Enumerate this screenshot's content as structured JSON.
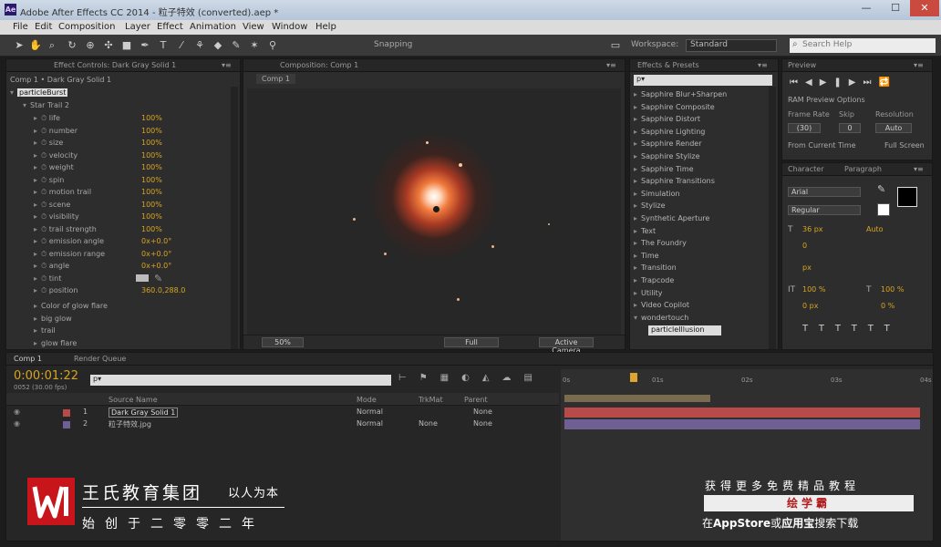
{
  "window": {
    "title": "Adobe After Effects CC 2014 - 粒子特效 (converted).aep *",
    "minimize": "—",
    "maximize": "☐",
    "close": "✕"
  },
  "menu": [
    "File",
    "Edit",
    "Composition",
    "Layer",
    "Effect",
    "Animation",
    "View",
    "Window",
    "Help"
  ],
  "toolbar": {
    "snapping": "Snapping",
    "workspace_label": "Workspace:",
    "workspace_value": "Standard",
    "search_placeholder": "Search Help"
  },
  "effect_controls": {
    "tab": "Effect Controls: Dark Gray Solid 1",
    "breadcrumb": "Comp 1 • Dark Gray Solid 1",
    "effect_name": "particleBurst",
    "group": "Star Trail 2",
    "props": [
      {
        "name": "life",
        "value": "100%"
      },
      {
        "name": "number",
        "value": "100%"
      },
      {
        "name": "size",
        "value": "100%"
      },
      {
        "name": "velocity",
        "value": "100%"
      },
      {
        "name": "weight",
        "value": "100%"
      },
      {
        "name": "spin",
        "value": "100%"
      },
      {
        "name": "motion trail",
        "value": "100%"
      },
      {
        "name": "scene",
        "value": "100%"
      },
      {
        "name": "visibility",
        "value": "100%"
      },
      {
        "name": "trail strength",
        "value": "100%"
      },
      {
        "name": "emission angle",
        "value": "0x+0.0°"
      },
      {
        "name": "emission range",
        "value": "0x+0.0°"
      },
      {
        "name": "angle",
        "value": "0x+0.0°"
      },
      {
        "name": "tint",
        "value": ""
      },
      {
        "name": "position",
        "value": "360.0,288.0"
      }
    ],
    "subgroups": [
      "Color of glow flare",
      "big glow",
      "trail",
      "glow flare"
    ]
  },
  "composition": {
    "tab": "Composition: Comp 1",
    "sub_tab": "Comp 1",
    "zoom": "50%",
    "quality": "Full",
    "view": "Active Camera"
  },
  "effects_presets": {
    "tab": "Effects & Presets",
    "search": "p▾",
    "items": [
      "Sapphire Blur+Sharpen",
      "Sapphire Composite",
      "Sapphire Distort",
      "Sapphire Lighting",
      "Sapphire Render",
      "Sapphire Stylize",
      "Sapphire Time",
      "Sapphire Transitions",
      "Simulation",
      "Stylize",
      "Synthetic Aperture",
      "Text",
      "The Foundry",
      "Time",
      "Transition",
      "Trapcode",
      "Utility",
      "Video Copilot",
      "wondertouch"
    ],
    "selected": "particleIllusion"
  },
  "preview": {
    "tab": "Preview",
    "ram_options": "RAM Preview Options",
    "frame_rate_label": "Frame Rate",
    "skip_label": "Skip",
    "resolution_label": "Resolution",
    "frame_rate": "(30)",
    "skip": "0",
    "resolution": "Auto",
    "from_current": "From Current Time",
    "full_screen": "Full Screen"
  },
  "character": {
    "tab": "Character",
    "tab2": "Paragraph",
    "font": "Arial",
    "style": "Regular",
    "size": "36 px",
    "leading": "Auto",
    "tracking": "0",
    "stroke": "px",
    "vscale": "100 %",
    "hscale": "100 %",
    "baseline": "0 px",
    "tsume": "0 %"
  },
  "timeline": {
    "tab": "Comp 1",
    "tab2": "Render Queue",
    "timecode": "0:00:01:22",
    "fps": "0052 (30.00 fps)",
    "search": "p▾",
    "col_source": "Source Name",
    "col_mode": "Mode",
    "col_trkmat": "TrkMat",
    "col_parent": "Parent",
    "layers": [
      {
        "num": "1",
        "name": "Dark Gray Solid 1",
        "mode": "Normal",
        "trk": "",
        "parent": "None"
      },
      {
        "num": "2",
        "name": "粒子特效.jpg",
        "mode": "Normal",
        "trk": "None",
        "parent": "None"
      }
    ],
    "ruler": [
      "0s",
      "",
      "01s",
      "",
      "02s",
      "",
      "03s",
      "",
      "04s"
    ]
  },
  "watermark": {
    "brand": "王氏教育集团",
    "slogan": "以人为本",
    "founded": "始创于二零零二年",
    "promo": "获得更多免费精品教程",
    "app_name": "绘学霸",
    "download_prefix": "在",
    "download_store": "AppStore",
    "download_or": "或",
    "download_store2": "应用宝",
    "download_suffix": "搜索下载"
  },
  "colors": {
    "accent_gold": "#d8a520",
    "layer_red": "#b84a4a",
    "layer_purple": "#6e5f95",
    "brand_red": "#c8151b"
  }
}
